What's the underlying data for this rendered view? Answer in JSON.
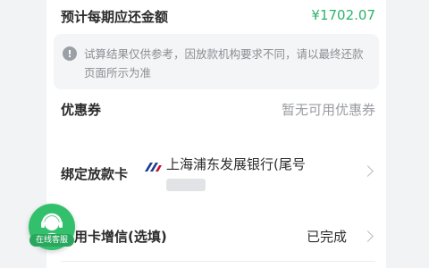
{
  "repayment": {
    "label": "预计每期应还金额",
    "amount": "¥1702.07"
  },
  "notice": {
    "icon": "info-icon",
    "text": "试算结果仅供参考，因放款机构要求不同，请以最终还款页面所示为准"
  },
  "coupon": {
    "label": "优惠券",
    "value": "暂无可用优惠券"
  },
  "bound_card": {
    "label": "绑定放款卡",
    "bank_name": "上海浦东发展银行(尾号",
    "bank_icon": "spdb-bank-logo-icon",
    "accent": "#1a3d8f"
  },
  "credit_card": {
    "label": "信用卡增信(选填)",
    "status": "已完成"
  },
  "service": {
    "label": "在线客服",
    "icon": "customer-service-agent-icon"
  },
  "colors": {
    "brand_green": "#2ab36b",
    "service_green": "#33c06d"
  }
}
